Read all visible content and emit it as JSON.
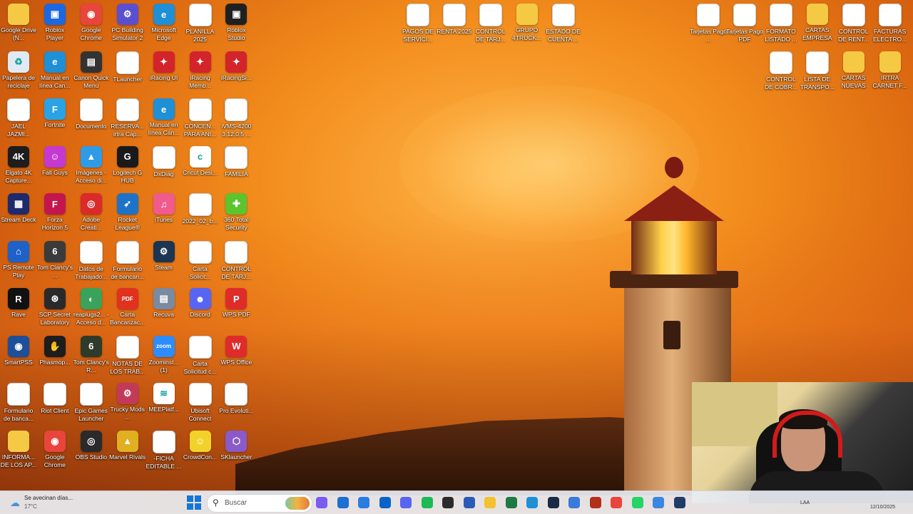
{
  "desktop": {
    "icons": [
      {
        "label": "Google Drive (N...",
        "kind": "folder",
        "col": 0,
        "row": 0,
        "color": "#f6c945"
      },
      {
        "label": "Roblox Player",
        "kind": "app",
        "col": 1,
        "row": 0,
        "color": "#1b68e0",
        "glyph": "▣"
      },
      {
        "label": "Google Chrome",
        "kind": "round",
        "col": 2,
        "row": 0,
        "color": "#e8453c",
        "glyph": "◉"
      },
      {
        "label": "PC Building Simulator 2",
        "kind": "app",
        "col": 3,
        "row": 0,
        "color": "#5b4fd1",
        "glyph": "⚙"
      },
      {
        "label": "Microsoft Edge",
        "kind": "round",
        "col": 4,
        "row": 0,
        "color": "#1f8fd6",
        "glyph": "e"
      },
      {
        "label": "PLANILLA 2025",
        "kind": "sheet",
        "col": 5,
        "row": 0
      },
      {
        "label": "Roblox Studio",
        "kind": "app",
        "col": 6,
        "row": 0,
        "color": "#202020",
        "glyph": "▣"
      },
      {
        "label": "Papelera de reciclaje",
        "kind": "app",
        "col": 0,
        "row": 1,
        "color": "#dfeaf3",
        "glyph": "♻"
      },
      {
        "label": "Manual en línea Can...",
        "kind": "round",
        "col": 1,
        "row": 1,
        "color": "#1f8fd6",
        "glyph": "e"
      },
      {
        "label": "Canon Quick Menu",
        "kind": "app",
        "col": 2,
        "row": 1,
        "color": "#333",
        "glyph": "▤"
      },
      {
        "label": "TLauncher",
        "kind": "doc",
        "col": 3,
        "row": 1
      },
      {
        "label": "iRacing UI",
        "kind": "app",
        "col": 4,
        "row": 1,
        "color": "#d3242b",
        "glyph": "✦"
      },
      {
        "label": "iRacing Memb...",
        "kind": "app",
        "col": 5,
        "row": 1,
        "color": "#d3242b",
        "glyph": "✦"
      },
      {
        "label": "iRacingSi...",
        "kind": "app",
        "col": 6,
        "row": 1,
        "color": "#d3242b",
        "glyph": "✦"
      },
      {
        "label": "JAEL JAZMI...",
        "kind": "doc",
        "col": 0,
        "row": 2
      },
      {
        "label": "Fortnite",
        "kind": "app",
        "col": 1,
        "row": 2,
        "color": "#2aa2e6",
        "glyph": "F"
      },
      {
        "label": "Documento",
        "kind": "doc",
        "col": 2,
        "row": 2
      },
      {
        "label": "RESERVA... irtra Cap...",
        "kind": "sheet",
        "col": 3,
        "row": 2
      },
      {
        "label": "Manual en línea Can...",
        "kind": "round",
        "col": 4,
        "row": 2,
        "color": "#1f8fd6",
        "glyph": "e"
      },
      {
        "label": "CONCEN... PARA ANI...",
        "kind": "doc",
        "col": 5,
        "row": 2
      },
      {
        "label": "iVMS-4200 3.12.0.5 ...",
        "kind": "doc",
        "col": 6,
        "row": 2
      },
      {
        "label": "Elgato 4K Capture...",
        "kind": "round",
        "col": 0,
        "row": 3,
        "color": "#1d1d1d",
        "glyph": "4K"
      },
      {
        "label": "Fall Guys",
        "kind": "app",
        "col": 1,
        "row": 3,
        "color": "#c43ad1",
        "glyph": "☺"
      },
      {
        "label": "Imágenes - Acceso di...",
        "kind": "app",
        "col": 2,
        "row": 3,
        "color": "#2f9be6",
        "glyph": "▲"
      },
      {
        "label": "Logitech G HUB",
        "kind": "round",
        "col": 3,
        "row": 3,
        "color": "#1a1a1a",
        "glyph": "G"
      },
      {
        "label": "DxDiag",
        "kind": "doc",
        "col": 4,
        "row": 3
      },
      {
        "label": "Cricut Desi...",
        "kind": "round",
        "col": 5,
        "row": 3,
        "color": "#ffffff",
        "glyph": "c"
      },
      {
        "label": "FAMILIA",
        "kind": "doc",
        "col": 6,
        "row": 3
      },
      {
        "label": "Stream Deck",
        "kind": "round",
        "col": 0,
        "row": 4,
        "color": "#1d2a6e",
        "glyph": "▦"
      },
      {
        "label": "Forza Horizon 5",
        "kind": "app",
        "col": 1,
        "row": 4,
        "color": "#c3164f",
        "glyph": "F"
      },
      {
        "label": "Adobe Creati...",
        "kind": "round",
        "col": 2,
        "row": 4,
        "color": "#da2a2a",
        "glyph": "◎"
      },
      {
        "label": "Rocket League®",
        "kind": "app",
        "col": 3,
        "row": 4,
        "color": "#1e72c8",
        "glyph": "➶"
      },
      {
        "label": "iTunes",
        "kind": "round",
        "col": 4,
        "row": 4,
        "color": "#f05a8c",
        "glyph": "♫"
      },
      {
        "label": "2022_02_b...",
        "kind": "doc",
        "col": 5,
        "row": 4
      },
      {
        "label": "360 Total Security",
        "kind": "round",
        "col": 6,
        "row": 4,
        "color": "#5cc42d",
        "glyph": "✚"
      },
      {
        "label": "PS Remote Play",
        "kind": "app",
        "col": 0,
        "row": 5,
        "color": "#1e62c8",
        "glyph": "⌂"
      },
      {
        "label": "Tom Clancy's ...",
        "kind": "app",
        "col": 1,
        "row": 5,
        "color": "#3b3b3b",
        "glyph": "6"
      },
      {
        "label": "Datos de Trabajado...",
        "kind": "sheet",
        "col": 2,
        "row": 5
      },
      {
        "label": "Formulario de bancari...",
        "kind": "doc",
        "col": 3,
        "row": 5
      },
      {
        "label": "Steam",
        "kind": "round",
        "col": 4,
        "row": 5,
        "color": "#1b3552",
        "glyph": "⚙"
      },
      {
        "label": "Carta Solicit...",
        "kind": "doc",
        "col": 5,
        "row": 5
      },
      {
        "label": "CONTROL DE TARJ...",
        "kind": "sheet",
        "col": 6,
        "row": 5
      },
      {
        "label": "Rave",
        "kind": "round",
        "col": 0,
        "row": 6,
        "color": "#111",
        "glyph": "R"
      },
      {
        "label": "SCP Secret Laboratory",
        "kind": "round",
        "col": 1,
        "row": 6,
        "color": "#2a2a2a",
        "glyph": "⊛"
      },
      {
        "label": "reaplugs2... - Acceso d...",
        "kind": "round",
        "col": 2,
        "row": 6,
        "color": "#3aa25a",
        "glyph": "◐"
      },
      {
        "label": "Carta Bancarizac...",
        "kind": "app",
        "col": 3,
        "row": 6,
        "color": "#e0321e",
        "glyph": "PDF"
      },
      {
        "label": "Recuva",
        "kind": "app",
        "col": 4,
        "row": 6,
        "color": "#7a8aa0",
        "glyph": "▤"
      },
      {
        "label": "Discord",
        "kind": "round",
        "col": 5,
        "row": 6,
        "color": "#5865f2",
        "glyph": "☻"
      },
      {
        "label": "WPS PDF",
        "kind": "app",
        "col": 6,
        "row": 6,
        "color": "#e02b2b",
        "glyph": "P"
      },
      {
        "label": "SmartPSS",
        "kind": "round",
        "col": 0,
        "row": 7,
        "color": "#1d4f9a",
        "glyph": "◉"
      },
      {
        "label": "Phasmop...",
        "kind": "app",
        "col": 1,
        "row": 7,
        "color": "#1d1d1d",
        "glyph": "✋"
      },
      {
        "label": "Tom Clancy's R...",
        "kind": "app",
        "col": 2,
        "row": 7,
        "color": "#2e3b2a",
        "glyph": "6"
      },
      {
        "label": "NOTAS DE LOS TRAB...",
        "kind": "doc",
        "col": 3,
        "row": 7
      },
      {
        "label": "Zoominst... (1)",
        "kind": "round",
        "col": 4,
        "row": 7,
        "color": "#2d8cff",
        "glyph": "zoom"
      },
      {
        "label": "Carta Solicitud c...",
        "kind": "doc",
        "col": 5,
        "row": 7
      },
      {
        "label": "WPS Office",
        "kind": "app",
        "col": 6,
        "row": 7,
        "color": "#e02b2b",
        "glyph": "W"
      },
      {
        "label": "Formulario de banca...",
        "kind": "doc",
        "col": 0,
        "row": 8
      },
      {
        "label": "Riot Client",
        "kind": "doc",
        "col": 1,
        "row": 8
      },
      {
        "label": "Epic Games Launcher",
        "kind": "doc",
        "col": 2,
        "row": 8
      },
      {
        "label": "Trucky Mods ...",
        "kind": "round",
        "col": 3,
        "row": 8,
        "color": "#c23a5a",
        "glyph": "⚙"
      },
      {
        "label": "MEEPlatf...",
        "kind": "app",
        "col": 4,
        "row": 8,
        "color": "#ffffff",
        "glyph": "≋"
      },
      {
        "label": "Ubisoft Connect",
        "kind": "doc",
        "col": 5,
        "row": 8
      },
      {
        "label": "Pro Evoluti...",
        "kind": "doc",
        "col": 6,
        "row": 8
      },
      {
        "label": "INFORMA... DE LOS AP...",
        "kind": "folder",
        "col": 0,
        "row": 9,
        "color": "#f6c945"
      },
      {
        "label": "Google Chrome",
        "kind": "round",
        "col": 1,
        "row": 9,
        "color": "#e8453c",
        "glyph": "◉"
      },
      {
        "label": "OBS Studio",
        "kind": "round",
        "col": 2,
        "row": 9,
        "color": "#2a2a2a",
        "glyph": "◎"
      },
      {
        "label": "Marvel Rivals",
        "kind": "app",
        "col": 3,
        "row": 9,
        "color": "#e0b020",
        "glyph": "▲"
      },
      {
        "label": "-FICHA EDITABLE ...",
        "kind": "doc",
        "col": 4,
        "row": 9
      },
      {
        "label": "CrowdCon...",
        "kind": "round",
        "col": 5,
        "row": 9,
        "color": "#f2d22a",
        "glyph": "☺"
      },
      {
        "label": "SKlauncher",
        "kind": "round",
        "col": 6,
        "row": 9,
        "color": "#8a5ac8",
        "glyph": "⬡"
      },
      {
        "label": "PAGOS DE SERVICI...",
        "kind": "sheet",
        "col": 11,
        "row": 0
      },
      {
        "label": "RENTA 2025",
        "kind": "sheet",
        "col": 12,
        "row": 0
      },
      {
        "label": "CONTROL DE TARJ...",
        "kind": "sheet",
        "col": 13,
        "row": 0
      },
      {
        "label": "GRUPO 4TRUCK...",
        "kind": "folder",
        "col": 14,
        "row": 0,
        "color": "#f6c945"
      },
      {
        "label": "ESTADO DE CUENTA ...",
        "kind": "sheet",
        "col": 15,
        "row": 0
      },
      {
        "label": "Tarjetas Pago ...",
        "kind": "doc",
        "col": 19,
        "row": 0
      },
      {
        "label": "Tarjetas Pago PDF",
        "kind": "doc",
        "col": 20,
        "row": 0
      },
      {
        "label": "FORMATO LISTADO ...",
        "kind": "sheet",
        "col": 21,
        "row": 0
      },
      {
        "label": "CARTAS EMPRESA",
        "kind": "folder",
        "col": 22,
        "row": 0,
        "color": "#f6c945"
      },
      {
        "label": "CONTROL DE RENT...",
        "kind": "sheet",
        "col": 23,
        "row": 0
      },
      {
        "label": "FACTURAS ELECTRO...",
        "kind": "doc",
        "col": 24,
        "row": 0
      },
      {
        "label": "CONTROL DE COBR...",
        "kind": "sheet",
        "col": 21,
        "row": 1
      },
      {
        "label": "LISTA DE TRANSPO...",
        "kind": "sheet",
        "col": 22,
        "row": 1
      },
      {
        "label": "CARTAS NUEVAS",
        "kind": "folder",
        "col": 23,
        "row": 1,
        "color": "#f6c945"
      },
      {
        "label": "IRTRA CARNET F...",
        "kind": "folder",
        "col": 24,
        "row": 1,
        "color": "#f6c945"
      }
    ]
  },
  "taskbar": {
    "weather_text": "Se avecinan días...",
    "weather_temp": "17°C",
    "search_placeholder": "Buscar",
    "apps": [
      {
        "name": "copilot",
        "color": "#7b5cf0"
      },
      {
        "name": "mail",
        "color": "#1d6fd1"
      },
      {
        "name": "store",
        "color": "#2a7de0"
      },
      {
        "name": "outlook",
        "color": "#0a64c8"
      },
      {
        "name": "discord",
        "color": "#5865f2"
      },
      {
        "name": "spotify",
        "color": "#1db954"
      },
      {
        "name": "obs",
        "color": "#2b2b2b"
      },
      {
        "name": "word",
        "color": "#2b5bb8"
      },
      {
        "name": "explorer",
        "color": "#f2c230"
      },
      {
        "name": "excel",
        "color": "#1e7a44"
      },
      {
        "name": "edge",
        "color": "#1f8fd6"
      },
      {
        "name": "app-dark",
        "color": "#1a2a44"
      },
      {
        "name": "app-window",
        "color": "#3a7ad8"
      },
      {
        "name": "illustrator",
        "color": "#b3301d"
      },
      {
        "name": "chrome",
        "color": "#e8453c"
      },
      {
        "name": "whatsapp",
        "color": "#25d366"
      },
      {
        "name": "snip",
        "color": "#3a86e0"
      },
      {
        "name": "photoshop",
        "color": "#1f3c68"
      }
    ],
    "tray_lang": "LAA",
    "tray_date": "12/10/2025"
  }
}
